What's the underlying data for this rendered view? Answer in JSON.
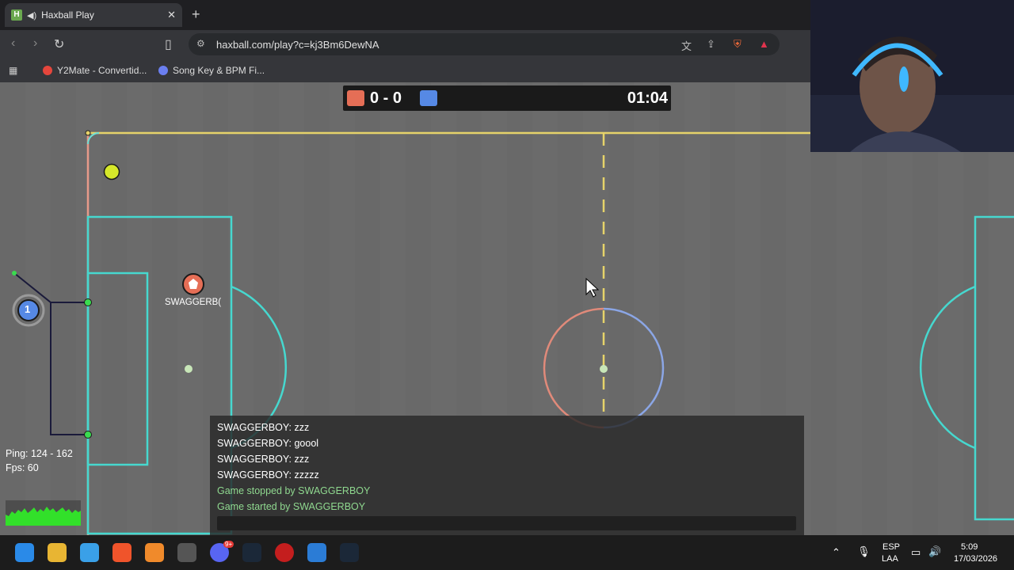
{
  "browser": {
    "tab_title": "Haxball Play",
    "favicon_letter": "H",
    "url": "haxball.com/play?c=kj3Bm6DewNA",
    "bookmarks": [
      "Y2Mate - Convertid...",
      "Song Key & BPM Fi..."
    ]
  },
  "scoreboard": {
    "score": "0 - 0",
    "time": "01:04",
    "red_color": "#e56e56",
    "blue_color": "#5689e5"
  },
  "game": {
    "player_name": "SWAGGERB(",
    "blue_player_number": "1"
  },
  "chat": {
    "messages": [
      {
        "text": "SWAGGERBOY: zzz",
        "type": "user"
      },
      {
        "text": "SWAGGERBOY: goool",
        "type": "user"
      },
      {
        "text": "SWAGGERBOY: zzz",
        "type": "user"
      },
      {
        "text": "SWAGGERBOY: zzzzz",
        "type": "user"
      },
      {
        "text": "Game stopped by SWAGGERBOY",
        "type": "system"
      },
      {
        "text": "Game started by SWAGGERBOY",
        "type": "system"
      }
    ],
    "user_color": "#ffffff",
    "system_color": "#8fd88f"
  },
  "stats": {
    "ping": "Ping: 124 - 162",
    "fps": "Fps: 60"
  },
  "taskbar": {
    "lang_top": "ESP",
    "lang_bottom": "LAA",
    "time": "5:09",
    "date": "17/03/2026",
    "discord_badge": "9+"
  }
}
